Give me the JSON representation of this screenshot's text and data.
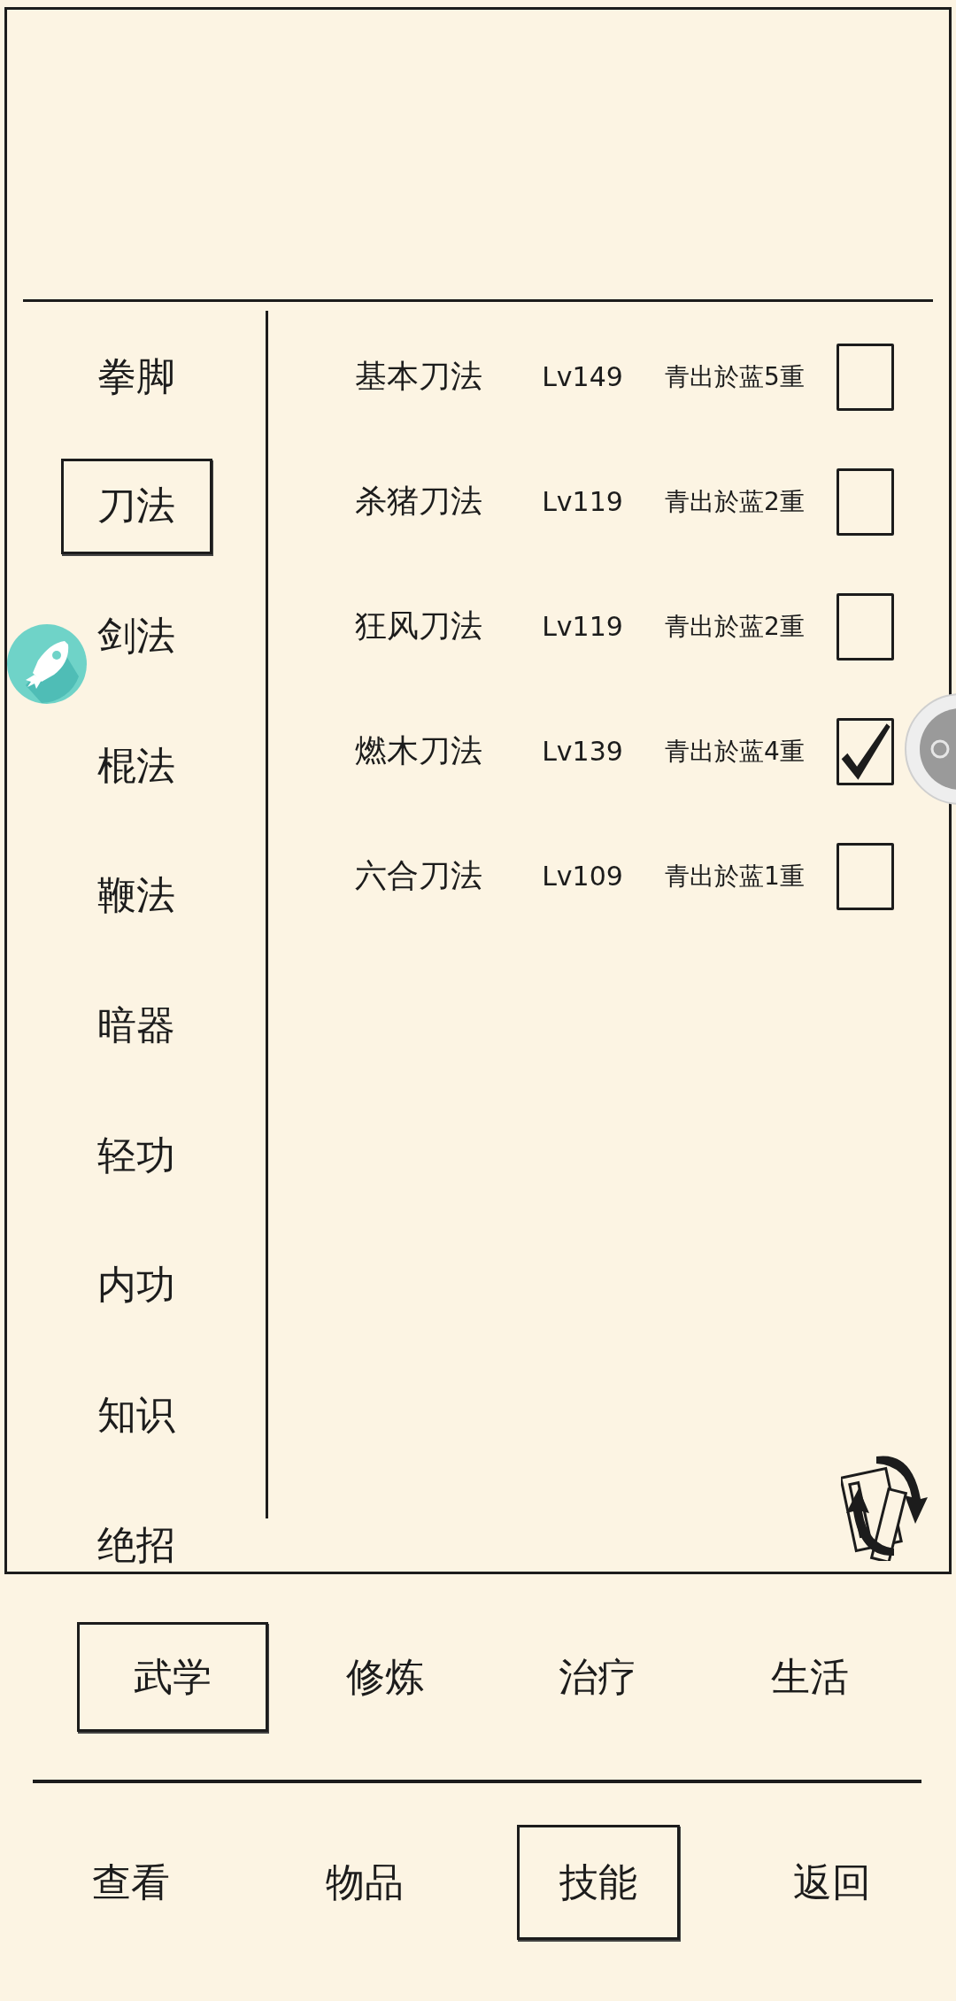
{
  "categories": [
    {
      "label": "拳脚",
      "selected": false
    },
    {
      "label": "刀法",
      "selected": true
    },
    {
      "label": "剑法",
      "selected": false
    },
    {
      "label": "棍法",
      "selected": false
    },
    {
      "label": "鞭法",
      "selected": false
    },
    {
      "label": "暗器",
      "selected": false
    },
    {
      "label": "轻功",
      "selected": false
    },
    {
      "label": "内功",
      "selected": false
    },
    {
      "label": "知识",
      "selected": false
    },
    {
      "label": "绝招",
      "selected": false
    }
  ],
  "skills": [
    {
      "name": "基本刀法",
      "lv": "Lv149",
      "tier": "青出於蓝5重",
      "checked": false
    },
    {
      "name": "杀猪刀法",
      "lv": "Lv119",
      "tier": "青出於蓝2重",
      "checked": false
    },
    {
      "name": "狂风刀法",
      "lv": "Lv119",
      "tier": "青出於蓝2重",
      "checked": false
    },
    {
      "name": "燃木刀法",
      "lv": "Lv139",
      "tier": "青出於蓝4重",
      "checked": true
    },
    {
      "name": "六合刀法",
      "lv": "Lv109",
      "tier": "青出於蓝1重",
      "checked": false
    }
  ],
  "subtabs": [
    {
      "label": "武学",
      "selected": true
    },
    {
      "label": "修炼",
      "selected": false
    },
    {
      "label": "治疗",
      "selected": false
    },
    {
      "label": "生活",
      "selected": false
    }
  ],
  "nav": [
    {
      "label": "查看",
      "selected": false
    },
    {
      "label": "物品",
      "selected": false
    },
    {
      "label": "技能",
      "selected": true
    },
    {
      "label": "返回",
      "selected": false
    }
  ]
}
